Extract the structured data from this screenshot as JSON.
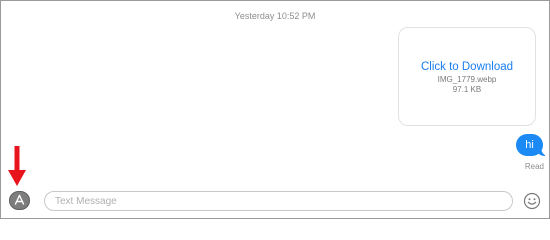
{
  "conversation": {
    "timestamp": "Yesterday 10:52 PM",
    "attachment": {
      "link_label": "Click to Download",
      "file_name": "IMG_1779.webp",
      "file_size": "97.1 KB"
    },
    "sent_message": {
      "text": "hi",
      "status": "Read"
    }
  },
  "compose": {
    "placeholder": "Text Message",
    "value": ""
  },
  "icons": {
    "apps": "app-store-icon",
    "emoji": "emoji-icon",
    "annotation": "red-arrow-icon"
  },
  "colors": {
    "bubble": "#1b8af5",
    "link": "#1a7ef0",
    "annotation_arrow": "#e8141c"
  }
}
